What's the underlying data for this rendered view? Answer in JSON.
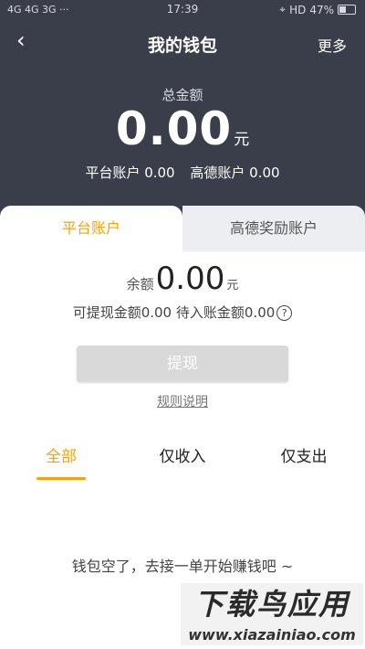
{
  "status_bar": {
    "network": "4G 4G 3G ···",
    "time": "17:39",
    "battery": "47%",
    "hd": "HD"
  },
  "navbar": {
    "back_icon": "chevron-left-icon",
    "title": "我的钱包",
    "more": "更多"
  },
  "summary": {
    "total_label": "总金额",
    "total_amount": "0.00",
    "total_unit": "元",
    "platform_account": "平台账户 0.00",
    "amap_account": "高德账户 0.00"
  },
  "tabs": [
    {
      "label": "平台账户",
      "active": true
    },
    {
      "label": "高德奖励账户",
      "active": false
    }
  ],
  "balance": {
    "label": "余额",
    "amount": "0.00",
    "unit": "元",
    "withdrawable": "可提现金额0.00",
    "pending": "待入账金额0.00",
    "help_icon": "question-circle-icon"
  },
  "withdraw_button": "提现",
  "rules_link": "规则说明",
  "filters": [
    {
      "label": "全部",
      "active": true
    },
    {
      "label": "仅收入",
      "active": false
    },
    {
      "label": "仅支出",
      "active": false
    }
  ],
  "empty_text": "钱包空了，去接一单开始赚钱吧 ~",
  "watermark": {
    "title": "下载鸟应用",
    "url": "www.xiazainiao.com"
  },
  "colors": {
    "header_bg": "#3a3d4a",
    "accent": "#f5a20a",
    "button_disabled": "#d9d9d9"
  }
}
